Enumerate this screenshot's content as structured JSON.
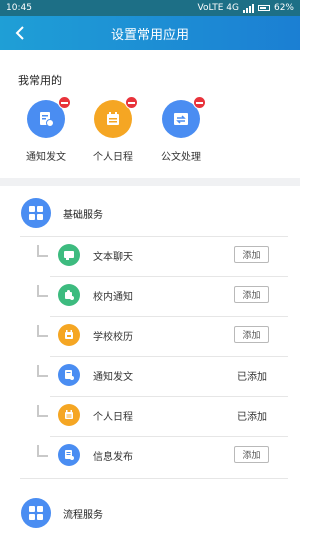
{
  "status_bar": {
    "time": "10:45",
    "network": "VoLTE 4G",
    "battery": "62%"
  },
  "header": {
    "title": "设置常用应用",
    "back_icon": "chevron-left-icon"
  },
  "favorites": {
    "heading": "我常用的",
    "items": [
      {
        "label": "通知发文",
        "icon": "notice-doc-icon",
        "color": "#4a8df2"
      },
      {
        "label": "个人日程",
        "icon": "schedule-icon",
        "color": "#f5a623"
      },
      {
        "label": "公文处理",
        "icon": "document-exchange-icon",
        "color": "#4a8df2"
      }
    ]
  },
  "groups": [
    {
      "label": "基础服务",
      "icon": "grid-icon",
      "items": [
        {
          "label": "文本聊天",
          "icon": "chat-icon",
          "color": "#3dbb7f",
          "action": "添加",
          "added": false
        },
        {
          "label": "校内通知",
          "icon": "campus-notice-icon",
          "color": "#3dbb7f",
          "action": "添加",
          "added": false
        },
        {
          "label": "学校校历",
          "icon": "calendar-icon",
          "color": "#f5a623",
          "action": "添加",
          "added": false
        },
        {
          "label": "通知发文",
          "icon": "notice-doc-icon",
          "color": "#4a8df2",
          "action": "已添加",
          "added": true
        },
        {
          "label": "个人日程",
          "icon": "schedule-icon",
          "color": "#f5a623",
          "action": "已添加",
          "added": true
        },
        {
          "label": "信息发布",
          "icon": "publish-icon",
          "color": "#4a8df2",
          "action": "添加",
          "added": false
        }
      ]
    },
    {
      "label": "流程服务",
      "icon": "grid-icon"
    }
  ]
}
